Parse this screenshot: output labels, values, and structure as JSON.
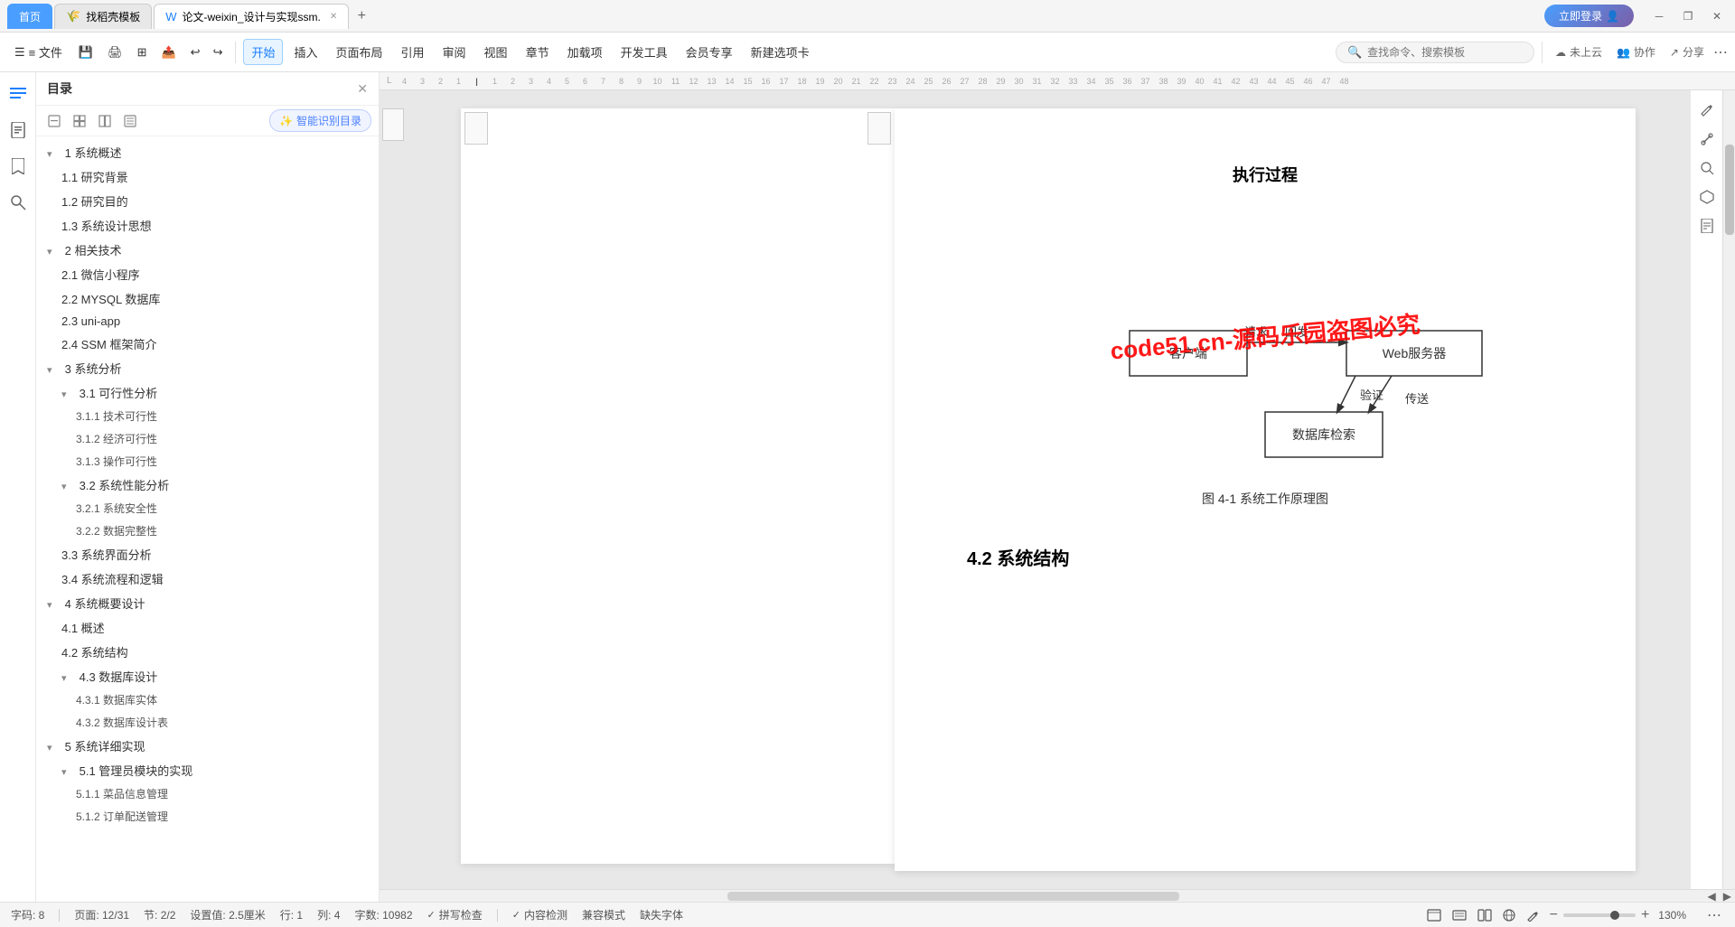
{
  "titlebar": {
    "home_tab": "首页",
    "template_tab": "找稻壳模板",
    "doc_tab": "论文-weixin_设计与实现ssm.",
    "register_btn": "立即登录",
    "win_min": "─",
    "win_restore": "❐",
    "win_close": "✕",
    "tab_add": "+"
  },
  "toolbar": {
    "menu_btn": "≡ 文件",
    "save_btn": "💾",
    "print_btn": "🖨",
    "export_btn": "📤",
    "share_btn": "📋",
    "undo_btn": "↩",
    "redo_btn": "↪",
    "start_btn": "开始",
    "insert_btn": "插入",
    "layout_btn": "页面布局",
    "ref_btn": "引用",
    "review_btn": "审阅",
    "view_btn": "视图",
    "chapter_btn": "章节",
    "additem_btn": "加载项",
    "devtool_btn": "开发工具",
    "member_btn": "会员专享",
    "newtab_btn": "新建选项卡",
    "search_placeholder": "查找命令、搜索模板",
    "cloud_btn": "未上云",
    "collab_btn": "协作",
    "share2_btn": "分享",
    "more_btn": "⋯"
  },
  "toc": {
    "title": "目录",
    "ai_label": "智能识别目录",
    "items": [
      {
        "level": 1,
        "text": "1 系统概述",
        "collapsed": false
      },
      {
        "level": 2,
        "text": "1.1  研究背景"
      },
      {
        "level": 2,
        "text": "1.2 研究目的"
      },
      {
        "level": 2,
        "text": "1.3 系统设计思想"
      },
      {
        "level": 1,
        "text": "2 相关技术",
        "collapsed": false
      },
      {
        "level": 2,
        "text": "2.1 微信小程序"
      },
      {
        "level": 2,
        "text": "2.2 MYSQL 数据库"
      },
      {
        "level": 2,
        "text": "2.3 uni-app"
      },
      {
        "level": 2,
        "text": "2.4 SSM 框架简介"
      },
      {
        "level": 1,
        "text": "3 系统分析",
        "collapsed": false
      },
      {
        "level": 2,
        "text": "3.1 可行性分析",
        "collapsed": false
      },
      {
        "level": 3,
        "text": "3.1.1 技术可行性"
      },
      {
        "level": 3,
        "text": "3.1.2 经济可行性"
      },
      {
        "level": 3,
        "text": "3.1.3 操作可行性"
      },
      {
        "level": 2,
        "text": "3.2 系统性能分析",
        "collapsed": false
      },
      {
        "level": 3,
        "text": "3.2.1  系统安全性"
      },
      {
        "level": 3,
        "text": "3.2.2  数据完整性"
      },
      {
        "level": 2,
        "text": "3.3 系统界面分析"
      },
      {
        "level": 2,
        "text": "3.4 系统流程和逻辑"
      },
      {
        "level": 1,
        "text": "4 系统概要设计",
        "collapsed": false
      },
      {
        "level": 2,
        "text": "4.1 概述"
      },
      {
        "level": 2,
        "text": "4.2 系统结构"
      },
      {
        "level": 2,
        "text": "4.3 数据库设计",
        "collapsed": false
      },
      {
        "level": 3,
        "text": "4.3.1 数据库实体"
      },
      {
        "level": 3,
        "text": "4.3.2 数据库设计表"
      },
      {
        "level": 1,
        "text": "5 系统详细实现",
        "collapsed": false
      },
      {
        "level": 2,
        "text": "5.1 管理员模块的实现",
        "collapsed": false
      },
      {
        "level": 3,
        "text": "5.1.1 菜品信息管理"
      },
      {
        "level": 3,
        "text": "5.1.2 订单配送管理"
      }
    ]
  },
  "document": {
    "section_title": "执行过程",
    "diagram": {
      "watermark": "code51.cn-源码乐园盗图必究",
      "client_label": "客户端",
      "server_label": "Web服务器",
      "db_label": "数据库检索",
      "arrow1_label": "回发",
      "arrow2_label": "验证",
      "arrow3_label": "传送",
      "caption": "图 4-1 系统工作原理图"
    },
    "subsection_title": "4.2 系统结构"
  },
  "statusbar": {
    "page_info": "页面: 12/31",
    "section_info": "节: 2/2",
    "position": "设置值: 2.5厘米",
    "line": "行: 1",
    "col": "列: 4",
    "char_count": "字数: 10982",
    "spell_check": "拼写检查",
    "content_check": "内容检测",
    "compat": "兼容模式",
    "missing_font": "缺失字体",
    "zoom": "130%",
    "words_label": "字码: 8"
  },
  "icons": {
    "menu": "☰",
    "toc": "☰",
    "bookmark": "🔖",
    "review": "💬",
    "search": "🔍",
    "close": "✕",
    "ai_star": "✨",
    "cloud": "☁",
    "collab": "👥",
    "share": "↗",
    "layout1": "⊞",
    "layout2": "⊟",
    "right_panel1": "✏",
    "right_panel2": "↗",
    "right_panel3": "🔍",
    "right_panel4": "⬡",
    "right_panel5": "📋"
  }
}
